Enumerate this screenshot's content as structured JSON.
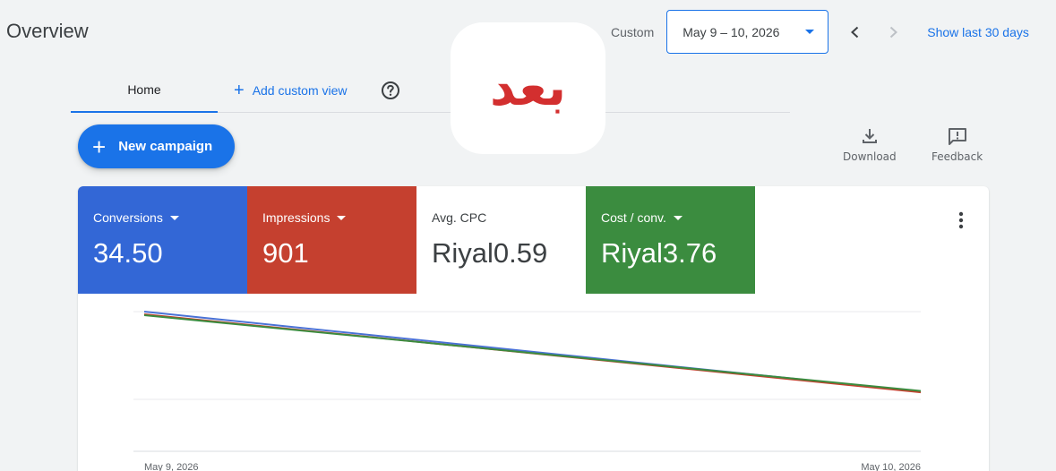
{
  "header": {
    "title": "Overview",
    "custom_label": "Custom",
    "date_range": "May 9 – 10, 2026",
    "show_last": "Show last 30 days"
  },
  "tabs": {
    "home": "Home",
    "add_custom_view": "Add custom view"
  },
  "overlay": {
    "text": "بعد"
  },
  "actions": {
    "new_campaign": "New campaign",
    "download": "Download",
    "feedback": "Feedback"
  },
  "metrics": [
    {
      "label": "Conversions",
      "value": "34.50",
      "color": "#3367d6",
      "has_dropdown": true
    },
    {
      "label": "Impressions",
      "value": "901",
      "color": "#c5402f",
      "has_dropdown": true
    },
    {
      "label": "Avg. CPC",
      "value": "Riyal0.59",
      "color": "#ffffff",
      "has_dropdown": false
    },
    {
      "label": "Cost / conv.",
      "value": "Riyal3.76",
      "color": "#3b8c3f",
      "has_dropdown": true
    }
  ],
  "chart_data": {
    "type": "line",
    "x": [
      "May 9, 2026",
      "May 10, 2026"
    ],
    "series": [
      {
        "name": "Conversions",
        "color": "#4a72d6",
        "values": [
          1.0,
          0.11
        ]
      },
      {
        "name": "Impressions",
        "color": "#c5402f",
        "values": [
          0.97,
          0.105
        ]
      },
      {
        "name": "Cost / conv.",
        "color": "#3b8c3f",
        "values": [
          0.96,
          0.12
        ]
      }
    ],
    "ylim": [
      -0.55,
      1.0
    ],
    "grid": true
  }
}
